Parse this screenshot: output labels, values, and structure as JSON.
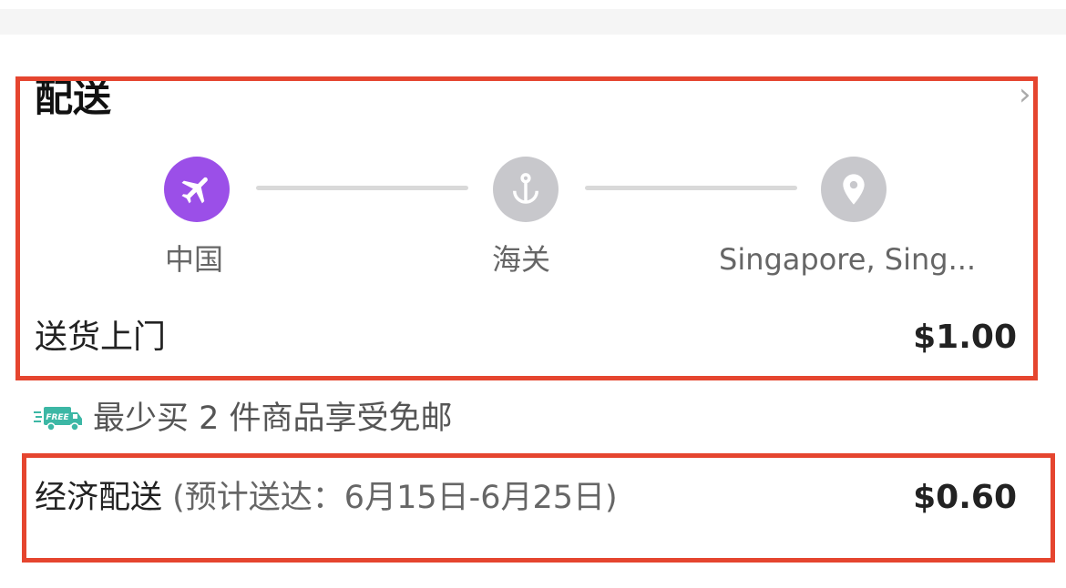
{
  "shipping": {
    "title": "配送",
    "close_icon": "close-icon",
    "route": {
      "steps": [
        {
          "label": "中国",
          "icon": "airplane-icon",
          "active": true
        },
        {
          "label": "海关",
          "icon": "anchor-icon",
          "active": false
        },
        {
          "label": "Singapore, Sing...",
          "icon": "location-pin-icon",
          "active": false
        }
      ]
    },
    "home_delivery": {
      "label": "送货上门",
      "price": "$1.00"
    },
    "free_shipping": {
      "badge_text": "FREE",
      "label": "最少买 2 件商品享受免邮"
    },
    "economy": {
      "label": "经济配送",
      "eta": " (预计送达：6月15日-6月25日)",
      "price": "$0.60"
    }
  },
  "colors": {
    "active_step": "#9b4fe8",
    "inactive_step": "#c8c8cc",
    "highlight_border": "#e5452f",
    "free_truck": "#3cb7a5"
  }
}
